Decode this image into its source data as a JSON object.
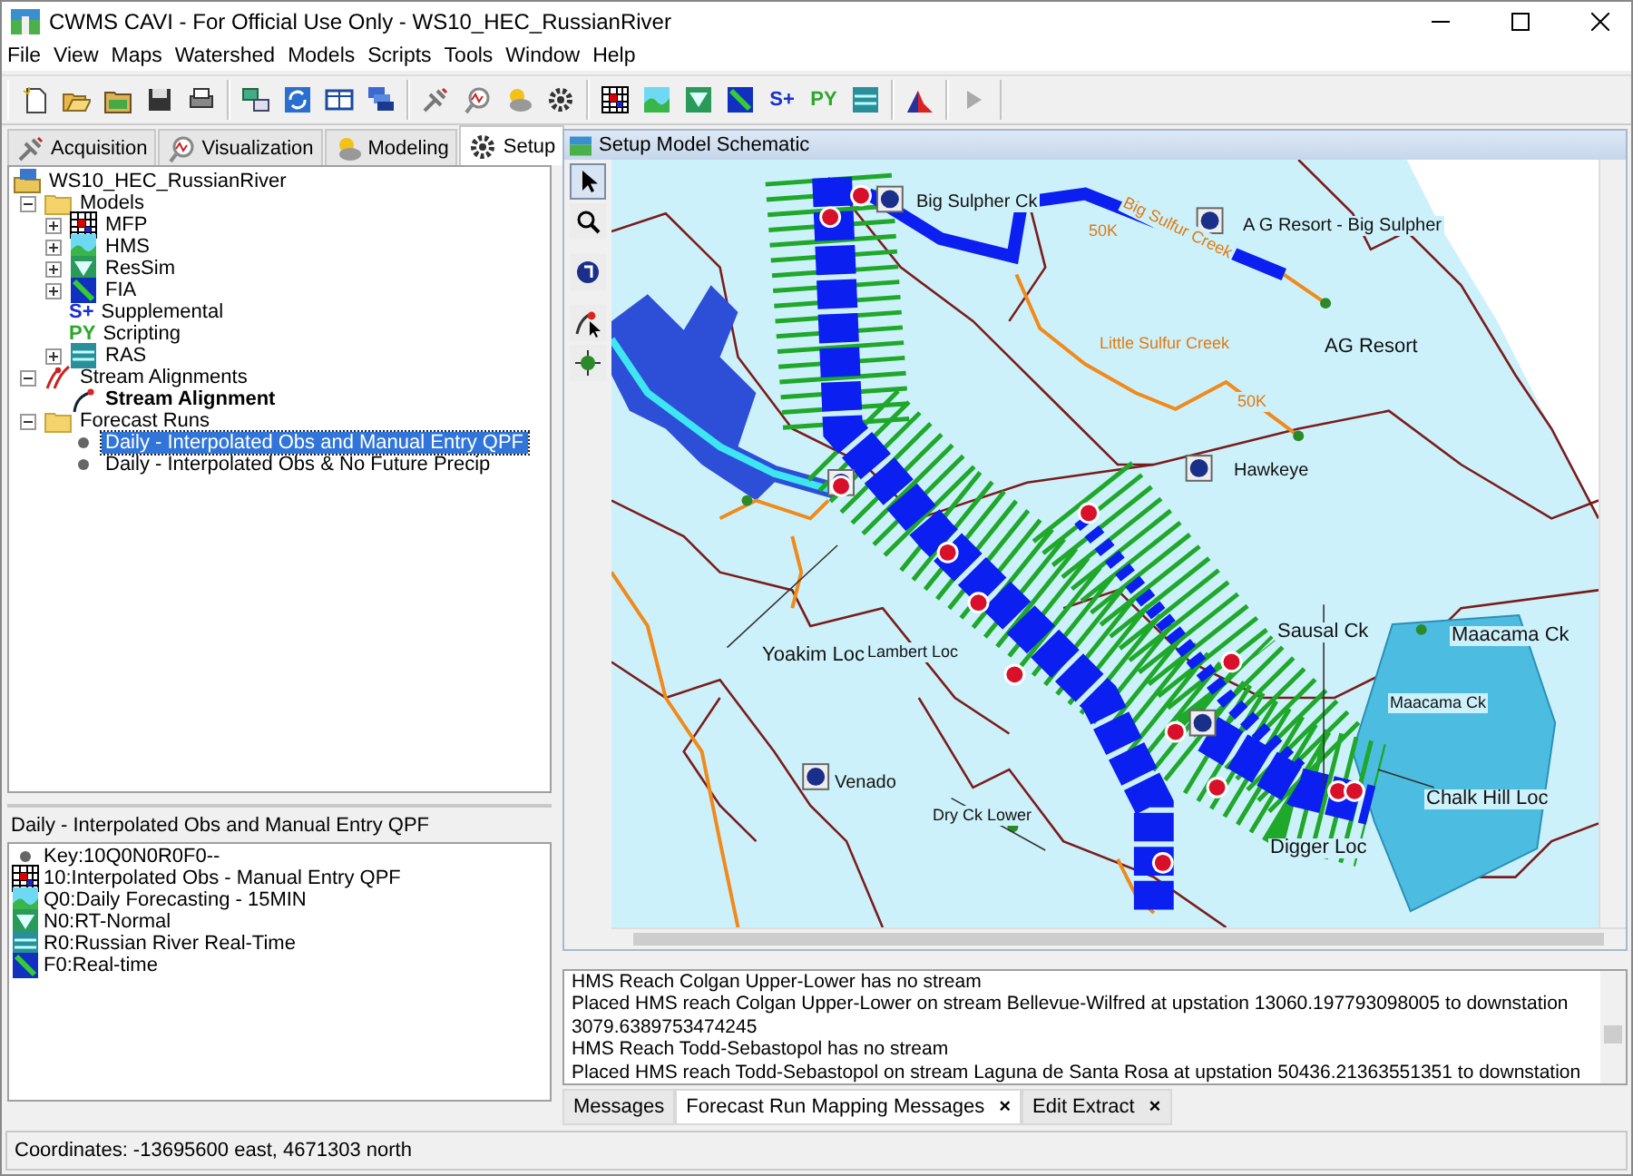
{
  "window": {
    "title": "CWMS CAVI - For Official Use Only  - WS10_HEC_RussianRiver"
  },
  "menu": [
    "File",
    "View",
    "Maps",
    "Watershed",
    "Models",
    "Scripts",
    "Tools",
    "Window",
    "Help"
  ],
  "toolbar_glyphs": [
    "S+",
    "PY"
  ],
  "left_tabs": [
    {
      "label": "Acquisition",
      "kind": "acquisition",
      "selected": false
    },
    {
      "label": "Visualization",
      "kind": "visualization",
      "selected": false
    },
    {
      "label": "Modeling",
      "kind": "modeling",
      "selected": false
    },
    {
      "label": "Setup",
      "kind": "setup",
      "selected": true
    }
  ],
  "tree": [
    {
      "label": "WS10_HEC_RussianRiver",
      "kind": "workspace",
      "selected": false,
      "children": [
        {
          "label": "Models",
          "kind": "folder",
          "expanded": true,
          "selected": false,
          "children": [
            {
              "label": "MFP",
              "kind": "grid",
              "expanded": false,
              "selected": false
            },
            {
              "label": "HMS",
              "kind": "hms",
              "expanded": false,
              "selected": false
            },
            {
              "label": "ResSim",
              "kind": "ressim",
              "expanded": false,
              "selected": false
            },
            {
              "label": "FIA",
              "kind": "fia",
              "expanded": false,
              "selected": false
            },
            {
              "label": "Supplemental",
              "kind": "glyph-s",
              "glyph": "S+",
              "selected": false
            },
            {
              "label": "Scripting",
              "kind": "glyph-py",
              "glyph": "PY",
              "selected": false
            },
            {
              "label": "RAS",
              "kind": "ras",
              "expanded": false,
              "selected": false
            }
          ]
        },
        {
          "label": "Stream Alignments",
          "kind": "streams",
          "expanded": true,
          "selected": false,
          "children": [
            {
              "label": "Stream Alignment",
              "kind": "alignment",
              "bold": true,
              "selected": false
            }
          ]
        },
        {
          "label": "Forecast Runs",
          "kind": "folder",
          "expanded": true,
          "selected": false,
          "children": [
            {
              "label": "Daily - Interpolated Obs and Manual Entry QPF",
              "kind": "dot",
              "selected": true
            },
            {
              "label": "Daily - Interpolated Obs & No Future Precip",
              "kind": "dot",
              "selected": false
            }
          ]
        }
      ]
    }
  ],
  "run_panel": {
    "title": "Daily - Interpolated Obs and Manual Entry QPF",
    "items": [
      {
        "kind": "dot",
        "label": "Key:10Q0N0R0F0--"
      },
      {
        "kind": "grid",
        "label": "10:Interpolated Obs - Manual Entry QPF"
      },
      {
        "kind": "hms",
        "label": "Q0:Daily Forecasting - 15MIN"
      },
      {
        "kind": "ressim",
        "label": "N0:RT-Normal"
      },
      {
        "kind": "ras",
        "label": "R0:Russian River Real-Time"
      },
      {
        "kind": "fia",
        "label": "F0:Real-time"
      }
    ]
  },
  "schematic": {
    "title": "Setup Model Schematic",
    "tools": [
      {
        "kind": "pointer",
        "selected": true
      },
      {
        "kind": "zoom",
        "selected": false
      },
      {
        "kind": "node",
        "selected": false
      },
      {
        "kind": "link",
        "selected": false
      },
      {
        "kind": "crosshair",
        "selected": false
      }
    ],
    "labels": [
      {
        "text": "Big Sulpher Ck",
        "kind": "node"
      },
      {
        "text": "A G Resort - Big Sulpher",
        "kind": "node"
      },
      {
        "text": "AG Resort",
        "kind": "gage"
      },
      {
        "text": "Big Sulfur Creek",
        "kind": "stream"
      },
      {
        "text": "Little Sulfur Creek",
        "kind": "stream"
      },
      {
        "text": "50K",
        "kind": "station"
      },
      {
        "text": "50K",
        "kind": "station"
      },
      {
        "text": "Hawkeye",
        "kind": "node"
      },
      {
        "text": "Yoakim Loc",
        "kind": "gage"
      },
      {
        "text": "Lambert Loc",
        "kind": "small"
      },
      {
        "text": "Sausal Ck",
        "kind": "gage"
      },
      {
        "text": "Maacama Ck",
        "kind": "gage"
      },
      {
        "text": "Maacama Ck",
        "kind": "small"
      },
      {
        "text": "Chalk Hill Loc",
        "kind": "gage"
      },
      {
        "text": "Venado",
        "kind": "node"
      },
      {
        "text": "Dry Ck Lower",
        "kind": "small"
      },
      {
        "text": "Digger Loc",
        "kind": "gage"
      }
    ]
  },
  "messages": [
    "HMS Reach Colgan Upper-Lower has no stream",
    "Placed HMS reach Colgan Upper-Lower on stream Bellevue-Wilfred at upstation 13060.197793098005 to downstation",
    "3079.6389753474245",
    "HMS Reach Todd-Sebastopol has no stream",
    "Placed HMS reach Todd-Sebastopol on stream Laguna de Santa Rosa at upstation 50436.21363551351 to downstation"
  ],
  "message_tabs": [
    {
      "label": "Messages",
      "selected": false
    },
    {
      "label": "Forecast Run Mapping Messages",
      "selected": true,
      "close": "×"
    },
    {
      "label": "Edit Extract",
      "selected": false,
      "close": "×"
    }
  ],
  "status_bar": {
    "text": "Coordinates: -13695600 east, 4671303 north"
  }
}
